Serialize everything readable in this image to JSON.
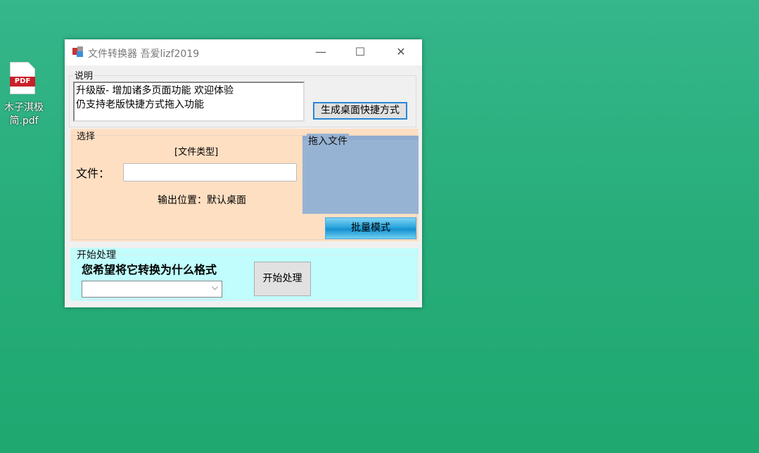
{
  "desktop": {
    "icon_label": "木子淇极简.pdf",
    "icon_badge": "PDF"
  },
  "window": {
    "title": "文件转换器  吾爱lizf2019",
    "minimize": "—",
    "maximize": "☐",
    "close": "✕"
  },
  "info": {
    "legend": "说明",
    "lines": [
      "升级版- 增加诸多页面功能 欢迎体验",
      "仍支持老版快捷方式拖入功能"
    ],
    "shortcut_button": "生成桌面快捷方式"
  },
  "select": {
    "legend": "选择",
    "file_type": "[文件类型]",
    "file_label": "文件：",
    "file_value": "",
    "output": "输出位置：默认桌面",
    "drop_legend": "拖入文件",
    "batch_button": "批量模式"
  },
  "process": {
    "legend": "开始处理",
    "question": "您希望将它转换为什么格式",
    "format_value": "",
    "start_button": "开始处理"
  },
  "colors": {
    "select_bg": "#ffdfc2",
    "drop_bg": "#97b3d4",
    "process_bg": "#c0fdfc"
  }
}
